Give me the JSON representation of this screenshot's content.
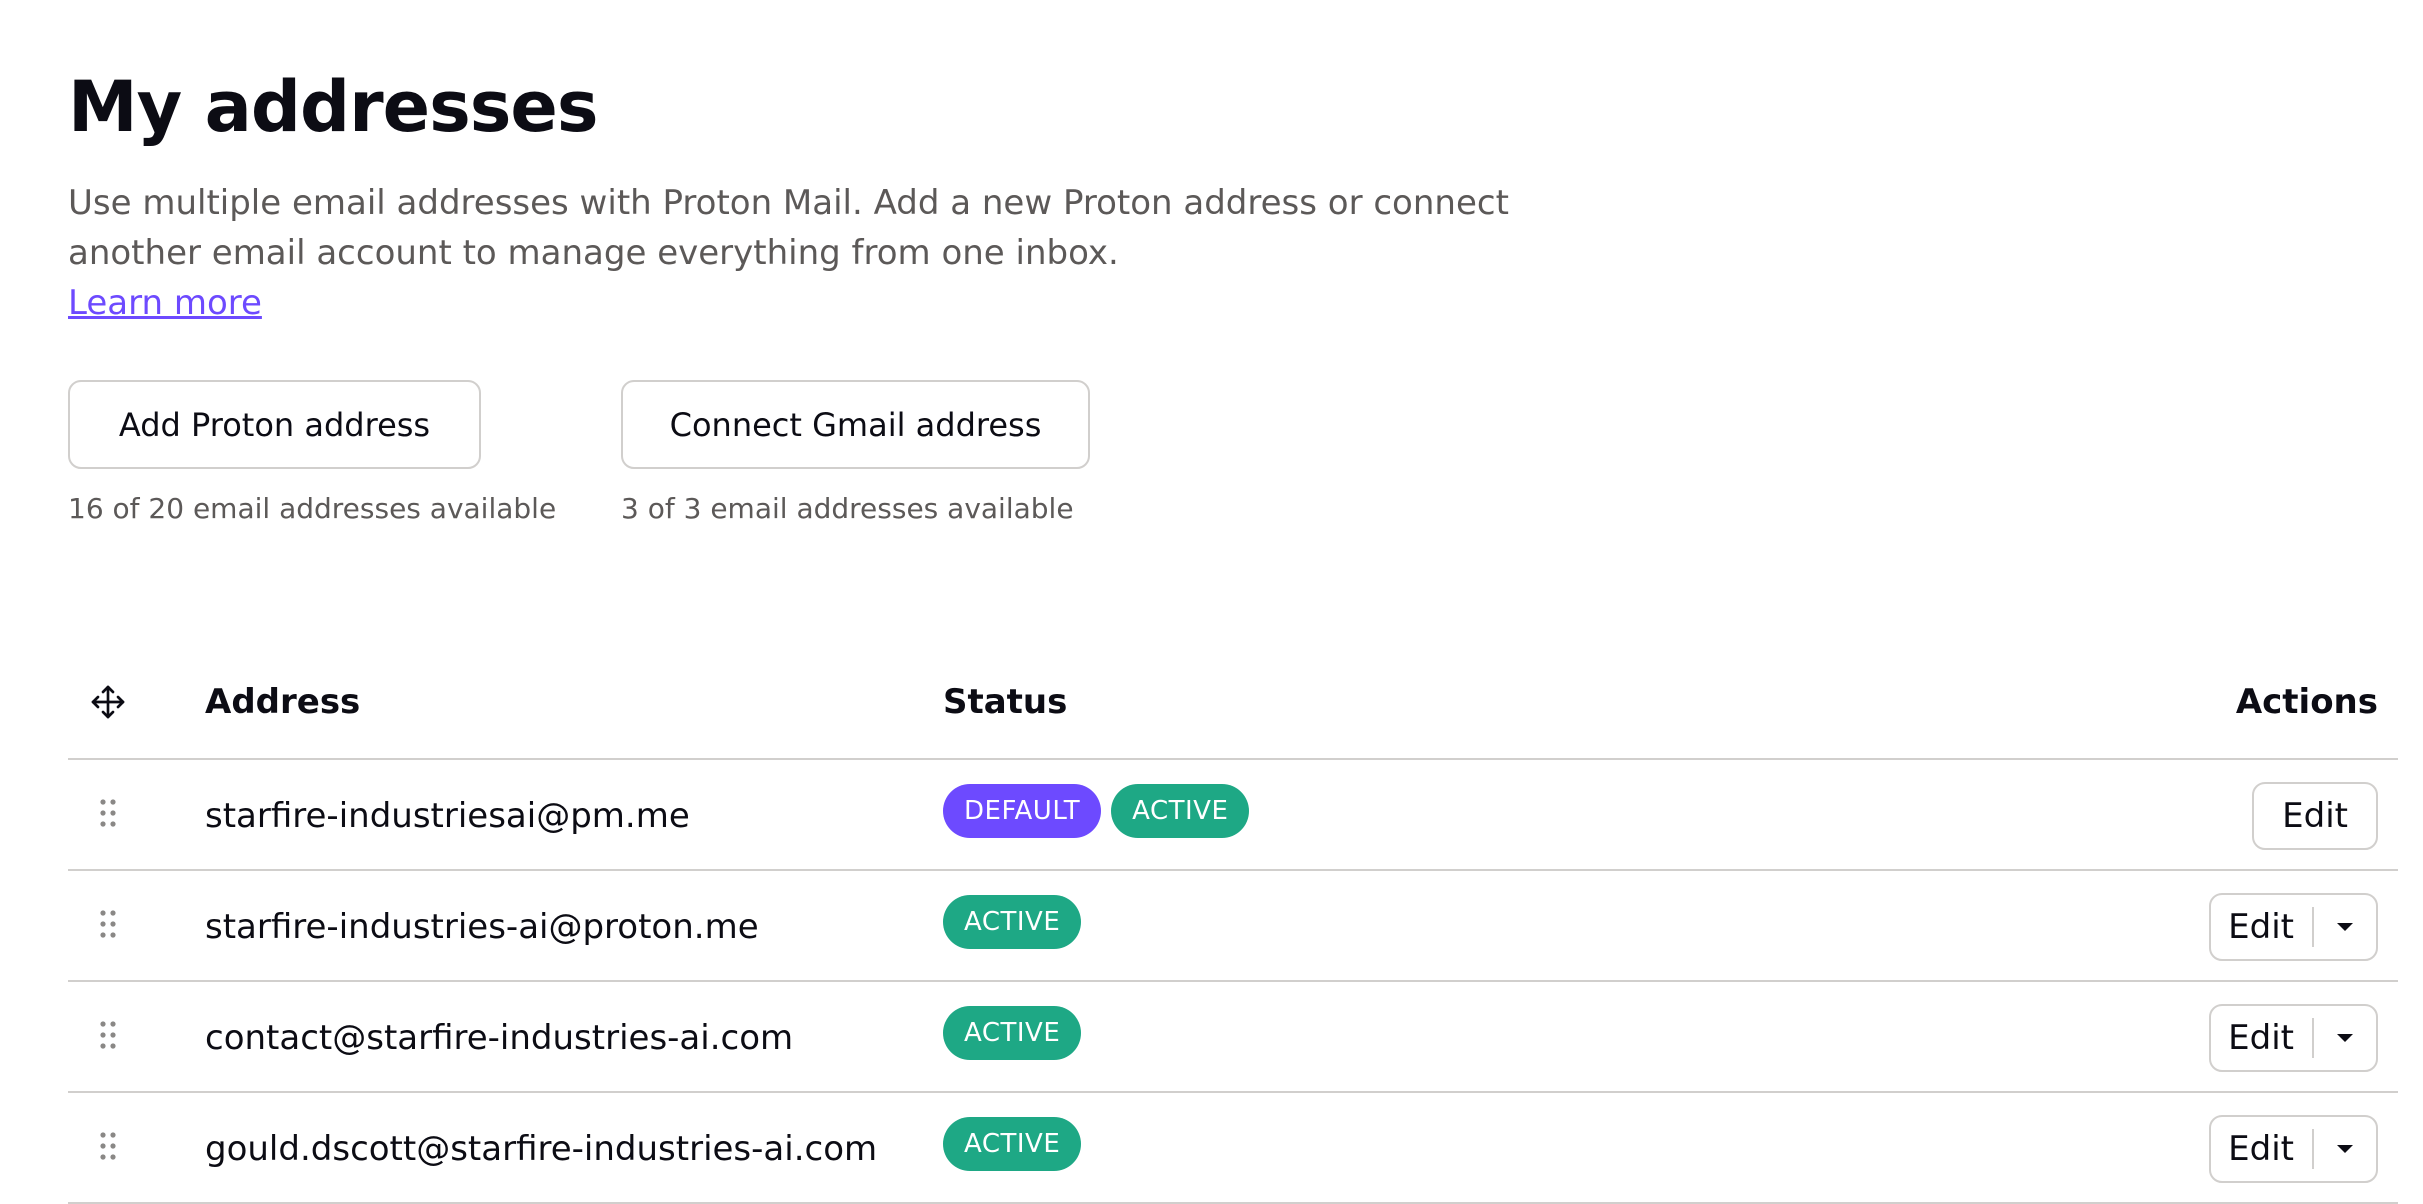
{
  "page": {
    "title": "My addresses",
    "description": "Use multiple email addresses with Proton Mail. Add a new Proton address or connect another email account to manage everything from one inbox.",
    "learn_more": "Learn more"
  },
  "actions": {
    "add_proton": {
      "label": "Add Proton address",
      "availability": "16 of 20 email addresses available"
    },
    "connect_gmail": {
      "label": "Connect Gmail address",
      "availability": "3 of 3 email addresses available"
    }
  },
  "table": {
    "headers": {
      "address": "Address",
      "status": "Status",
      "actions": "Actions"
    },
    "rows": [
      {
        "address": "starfire-industriesai@pm.me",
        "badges": [
          "DEFAULT",
          "ACTIVE"
        ],
        "action": "Edit"
      },
      {
        "address": "starfire-industries-ai@proton.me",
        "badges": [
          "ACTIVE"
        ],
        "action": "Edit"
      },
      {
        "address": "contact@starfire-industries-ai.com",
        "badges": [
          "ACTIVE"
        ],
        "action": "Edit"
      },
      {
        "address": "gould.dscott@starfire-industries-ai.com",
        "badges": [
          "ACTIVE"
        ],
        "action": "Edit"
      }
    ]
  },
  "colors": {
    "accent": "#6d4aff",
    "active_badge": "#1ea885",
    "text": "#0c0c14",
    "muted_text": "#5c5958",
    "border": "#d1cfcd"
  },
  "icons": {
    "header_reorder": "move-arrows-icon",
    "row_reorder": "drag-handle-icon",
    "dropdown": "caret-down-icon"
  }
}
